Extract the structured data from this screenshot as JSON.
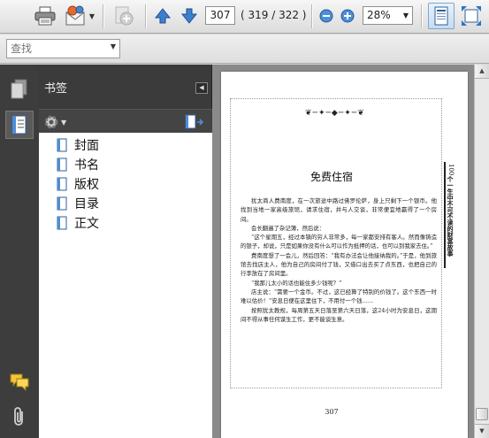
{
  "toolbar": {
    "current_page": "307",
    "page_count": "( 319 / 322 )",
    "zoom": "28%",
    "icons": [
      "printer-icon",
      "email-icon",
      "collaborate-icon",
      "prev-page-icon",
      "next-page-icon",
      "zoom-out-icon",
      "zoom-in-icon",
      "fit-page-icon",
      "fullscreen-icon"
    ]
  },
  "find": {
    "placeholder": "查找"
  },
  "bookmarks": {
    "title": "书签",
    "items": [
      {
        "label": "封面"
      },
      {
        "label": "书名"
      },
      {
        "label": "版权"
      },
      {
        "label": "目录"
      },
      {
        "label": "正文"
      }
    ]
  },
  "document": {
    "chapter_title": "免费住宿",
    "page_number": "307",
    "side_number": "100",
    "side_title": "个一生中不可不读的财富故事",
    "paragraphs": [
      "犹太商人费南度，在一次旅途中路过佛罗伦萨，身上只剩下一个银币。他找到当地一家高级旅馆，请求住宿，并与人交谈，非常便宜地赢得了一个房间。",
      "会长翻遍了杂记簿，然后说：",
      "“这个星期五，经过本镇的穷人非常多，每一家都安排有客人。然而像铸造的银子，却说，只是如果你没有什么可以作为抵押的话，也可以到我家去住。”",
      "费南度想了一会儿，然后回答：“我有办法会让他接纳我的。”于是，他到旅馆去找店主人，他为自己的房间付了钱，又借口出去买了点东西，也把自己的行李放在了房间里。",
      "“我那儿太小的话也能住多少钱呢？”",
      "店主说：“需要一个金币。不过，这已经算了特别的价钱了。这个东西一时难以估价！”安息日便在这里住下，不用付一个钱……",
      "按照犹太教规，每周第五天日落至第六天日落，这24小时为安息日，这期间不得从事任何谋生工作，更不能谈生意。"
    ]
  }
}
